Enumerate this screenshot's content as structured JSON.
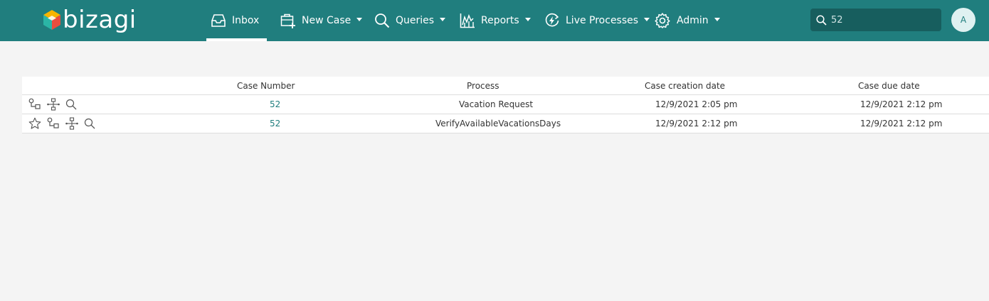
{
  "brand": {
    "name": "bizagi"
  },
  "nav": {
    "inbox": "Inbox",
    "new_case": "New Case",
    "queries": "Queries",
    "reports": "Reports",
    "live_processes": "Live Processes",
    "admin": "Admin"
  },
  "search": {
    "value": "52"
  },
  "user": {
    "initial": "A"
  },
  "grid": {
    "columns": [
      "Case Number",
      "Process",
      "Case creation date",
      "Case due date"
    ],
    "rows": [
      {
        "case_number": "52",
        "process": "Vacation Request",
        "created": "12/9/2021 2:05 pm",
        "due": "12/9/2021 2:12 pm",
        "actions": [
          "route-icon",
          "workflow-icon",
          "search-icon"
        ]
      },
      {
        "case_number": "52",
        "process": "VerifyAvailableVacationsDays",
        "created": "12/9/2021 2:12 pm",
        "due": "12/9/2021 2:12 pm",
        "actions": [
          "star-icon",
          "route-icon",
          "workflow-icon",
          "search-icon"
        ]
      }
    ]
  },
  "colors": {
    "header_bg": "#207e7e",
    "search_bg": "#175e5e",
    "link": "#207e7e",
    "page_bg": "#f4f4f4"
  }
}
